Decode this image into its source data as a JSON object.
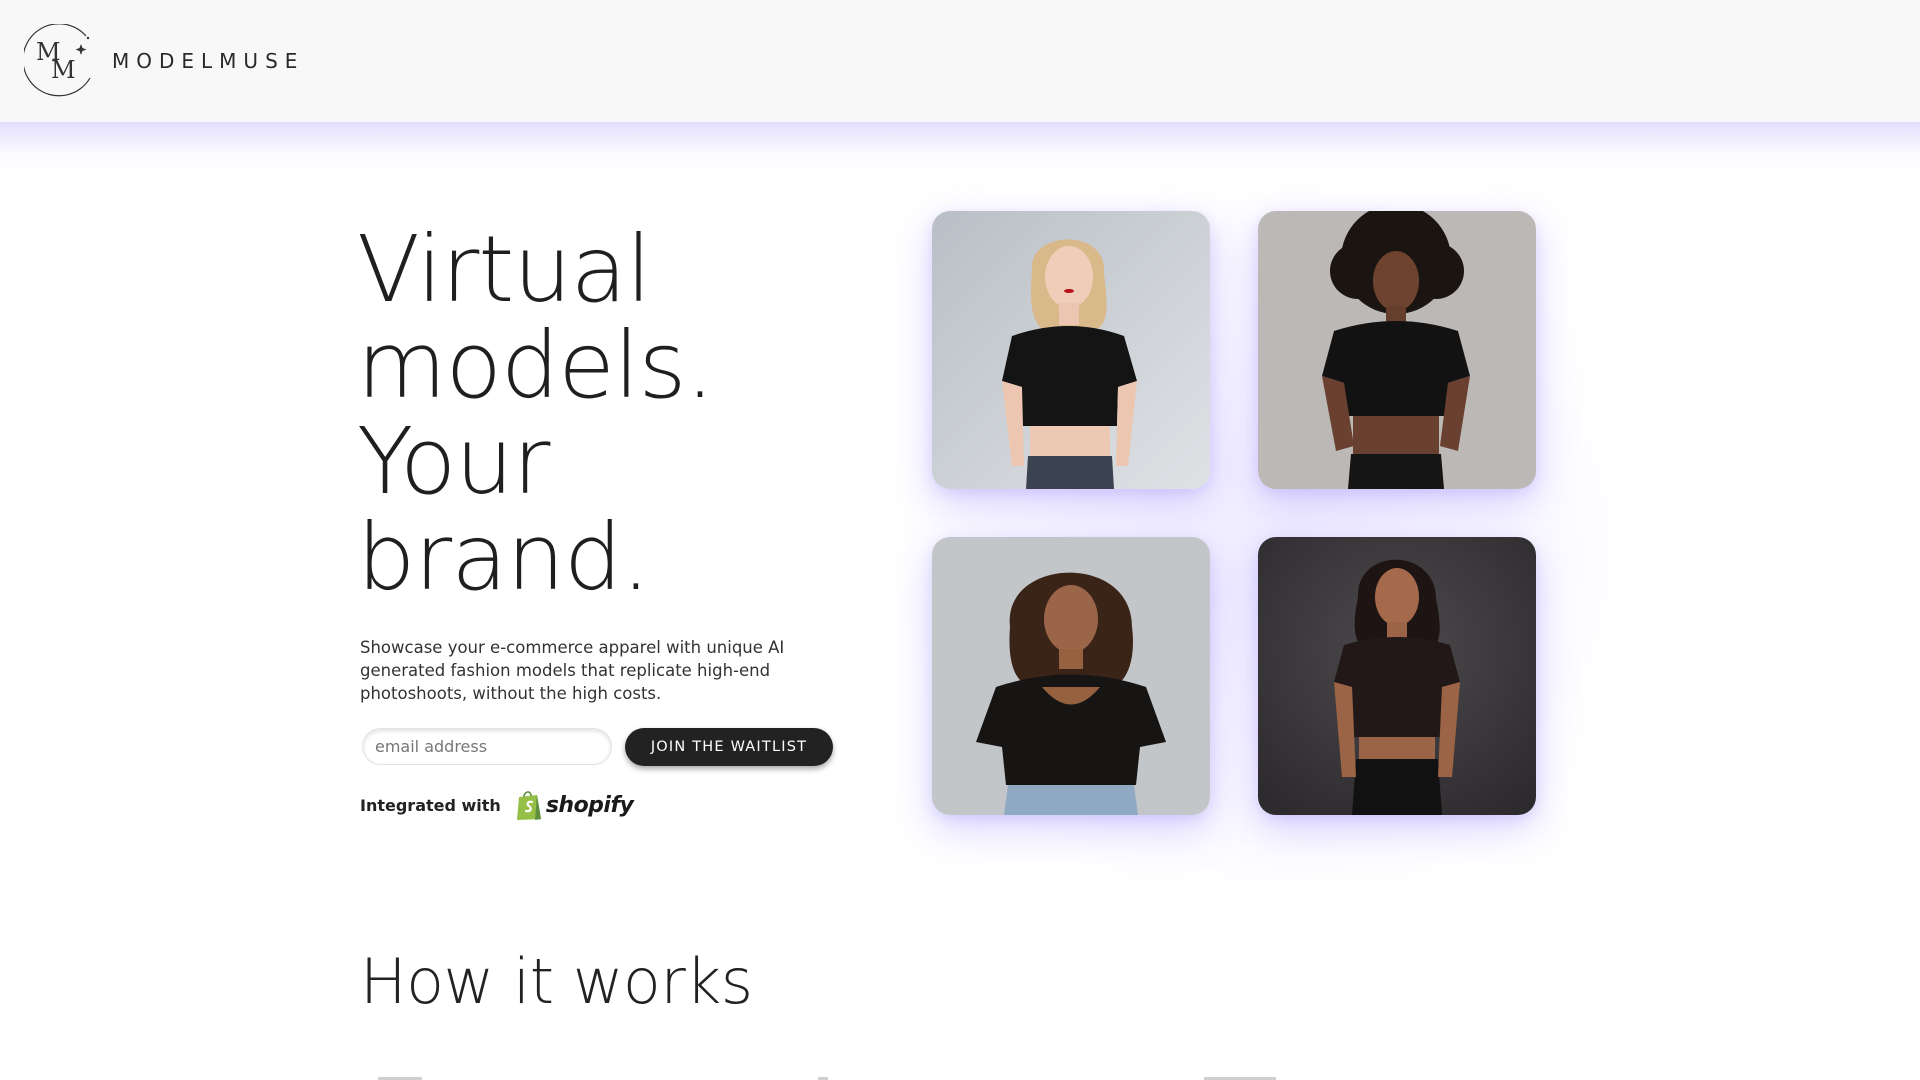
{
  "brand": {
    "name": "MODELMUSE",
    "logo_letters": "MM"
  },
  "hero": {
    "title_lines": [
      "Virtual",
      "models.",
      "Your",
      "brand."
    ],
    "subtitle": "Showcase your e-commerce apparel with unique AI generated fashion models that replicate high-end photoshoots, without the high costs.",
    "email_placeholder": "email address",
    "cta_label": "JOIN THE WAITLIST",
    "integrated_label": "Integrated with",
    "partner_name": "shopify"
  },
  "models": [
    {
      "description": "blonde model in black crop top",
      "bg": "#c9cdd2",
      "hair": "#d9b98a",
      "skin": "#f0cdb8"
    },
    {
      "description": "model with curly black hair in black crop top",
      "bg": "#bdb9b7",
      "hair": "#1b1512",
      "skin": "#6d4330"
    },
    {
      "description": "curly hair model in black top and jeans",
      "bg": "#c3c6c8",
      "hair": "#3a2418",
      "skin": "#9a6548"
    },
    {
      "description": "dark hair model in black crop top",
      "bg": "#403d40",
      "hair": "#1d1413",
      "skin": "#a56a4c"
    }
  ],
  "sections": {
    "how_it_works": "How it works"
  },
  "colors": {
    "accent_glow": "#cfc3ff",
    "button_bg": "#222222",
    "shopify_green": "#95bf47"
  },
  "icons": {
    "logo": "mm-monogram-icon",
    "shopify": "shopify-bag-icon"
  }
}
